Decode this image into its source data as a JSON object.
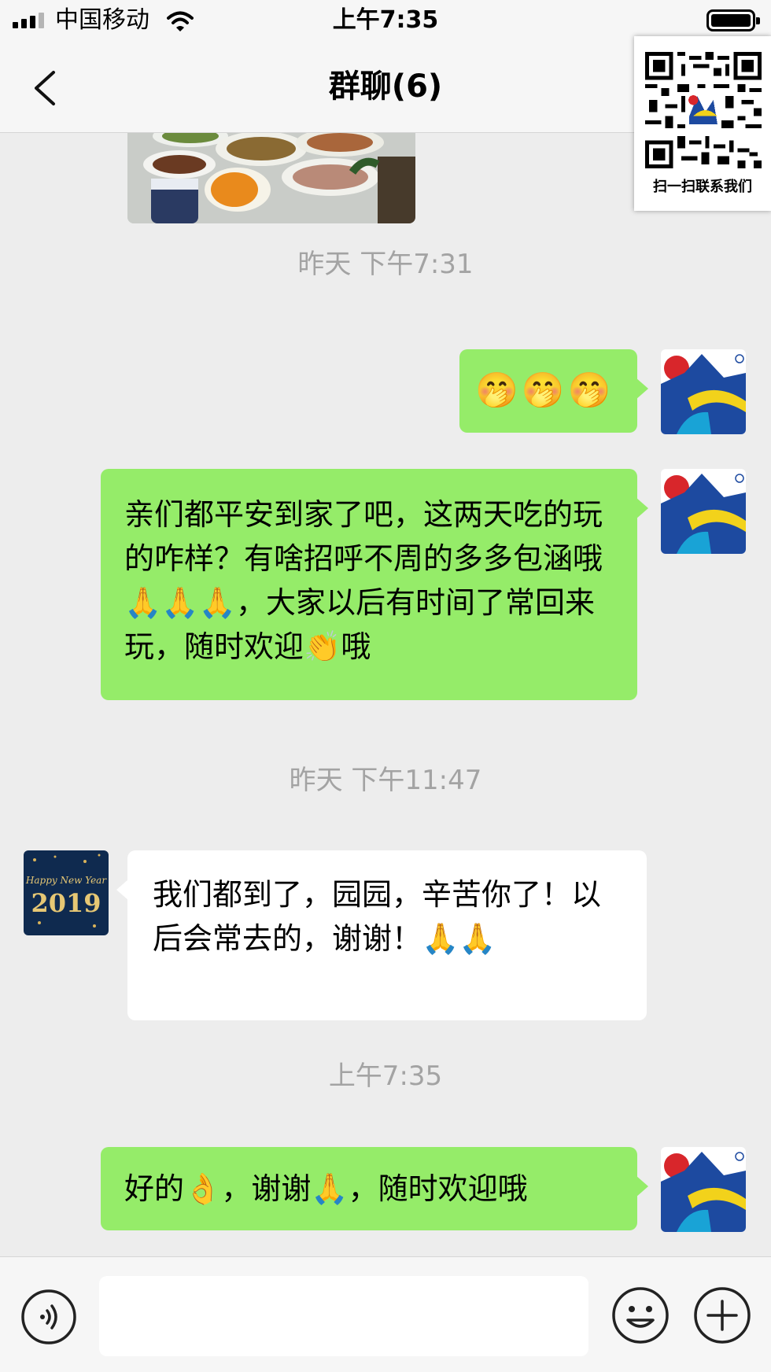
{
  "status_bar": {
    "carrier": "中国移动",
    "time": "上午7:35"
  },
  "nav": {
    "title": "群聊(6)"
  },
  "qr_overlay": {
    "caption": "扫一扫联系我们"
  },
  "messages": [
    {
      "type": "timestamp",
      "text": "昨天 下午7:31"
    },
    {
      "type": "outgoing",
      "sender": "self",
      "text": "🤭🤭🤭"
    },
    {
      "type": "outgoing",
      "sender": "self",
      "text": "亲们都平安到家了吧，这两天吃的玩的咋样？有啥招呼不周的多多包涵哦🙏🙏🙏，大家以后有时间了常回来玩，随时欢迎👏哦"
    },
    {
      "type": "timestamp",
      "text": "昨天 下午11:47"
    },
    {
      "type": "incoming",
      "sender": "member",
      "text": "我们都到了，园园，辛苦你了！以后会常去的，谢谢！🙏🙏"
    },
    {
      "type": "timestamp",
      "text": "上午7:35"
    },
    {
      "type": "outgoing",
      "sender": "self",
      "text": "好的👌，谢谢🙏，随时欢迎哦"
    }
  ],
  "avatars": {
    "member_avatar_text_top": "Happy New Year",
    "member_avatar_text_bottom": "2019"
  },
  "input_bar": {
    "placeholder": ""
  },
  "colors": {
    "outgoing_bubble": "#95ec69",
    "incoming_bubble": "#ffffff",
    "background": "#ededed"
  },
  "icons": [
    "back-icon",
    "wifi-icon",
    "battery-icon",
    "voice-icon",
    "emoji-icon",
    "plus-icon"
  ]
}
